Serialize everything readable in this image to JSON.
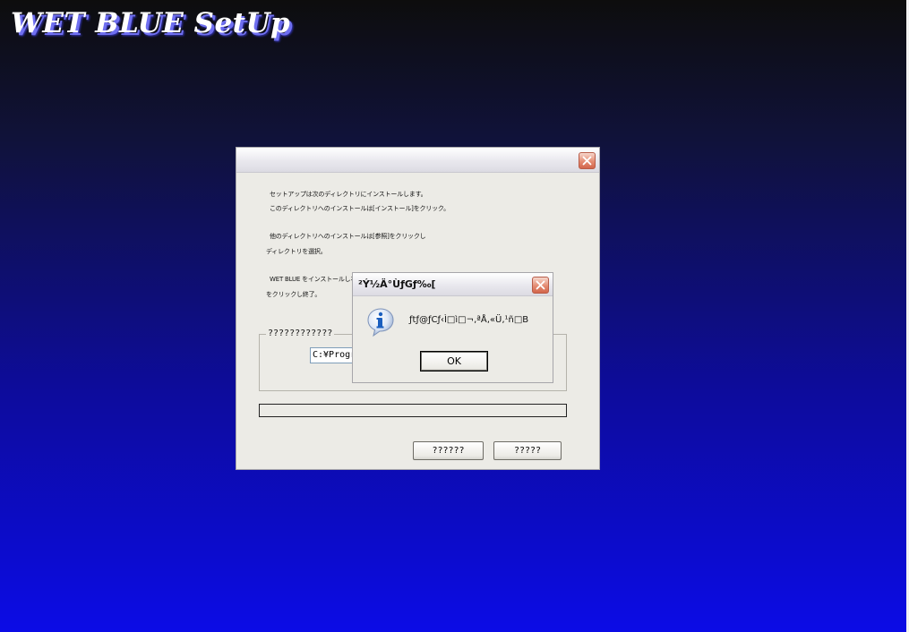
{
  "app": {
    "title": "WET BLUE SetUp"
  },
  "setup": {
    "text_lines": [
      "セットアップは次のディレクトリにインストールします。",
      "このディレクトリへのインストールは[インストール]をクリック。",
      "他のディレクトリへのインストールは[参照]をクリックし",
      "ディレクトリを選択。",
      "WET BLUE をインストールしない",
      "をクリックし終了。"
    ],
    "group_label": "????????????",
    "path_value": "C:¥Program Files¥",
    "button_1": "??????",
    "button_2": "?????"
  },
  "message_box": {
    "title": "²Ý½Ä°ÙƒGƒ‰[",
    "message": "ƒtƒ@ƒCƒ‹Ì□ì□¬‚ªÅ‚«Ü‚¹ñ□B",
    "ok_label": "OK"
  },
  "colors": {
    "background_top": "#0d0d0d",
    "background_bottom": "#0c0ce6",
    "window_face": "#ecebe6",
    "close_button": "#d2654b",
    "info_icon": "#1b5fbf"
  },
  "icons": [
    "close-icon",
    "info-icon"
  ]
}
